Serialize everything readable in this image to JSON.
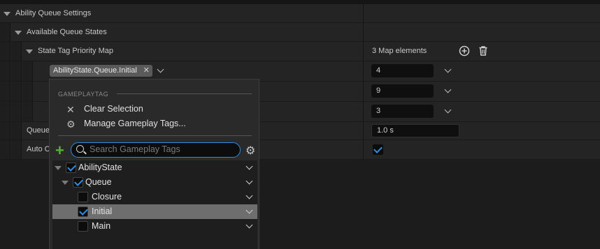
{
  "rows": {
    "ability_queue_settings": "Ability Queue Settings",
    "available_queue_states": "Available Queue States",
    "state_tag_priority_map": "State Tag Priority Map",
    "map_elements": "3 Map elements",
    "queue_duration_label": "Queue",
    "auto_label": "Auto C"
  },
  "map_entries": [
    {
      "key": "AbilityState.Queue.Initial",
      "value": "4"
    },
    {
      "key": "",
      "value": "9"
    },
    {
      "key": "",
      "value": "3"
    }
  ],
  "queue_duration": "1.0 s",
  "auto_checked": true,
  "popup": {
    "section_title": "GAMEPLAYTAG",
    "clear_selection": "Clear Selection",
    "manage_tags": "Manage Gameplay Tags...",
    "search_placeholder": "Search Gameplay Tags",
    "tree": [
      {
        "label": "AbilityState",
        "checked": true
      },
      {
        "label": "Queue",
        "checked": true
      },
      {
        "label": "Closure",
        "checked": false
      },
      {
        "label": "Initial",
        "checked": true,
        "selected": true
      },
      {
        "label": "Main",
        "checked": false
      }
    ]
  },
  "icons": {
    "add": "add-circle-icon",
    "delete": "trash-icon",
    "clear": "close-icon",
    "manage": "gear-icon",
    "search": "search-icon",
    "new_tag": "plus-icon",
    "settings": "gear-icon"
  },
  "colors": {
    "accent": "#2f8de4",
    "add_green": "#58b03a",
    "selected_row": "#6e6e6e"
  }
}
